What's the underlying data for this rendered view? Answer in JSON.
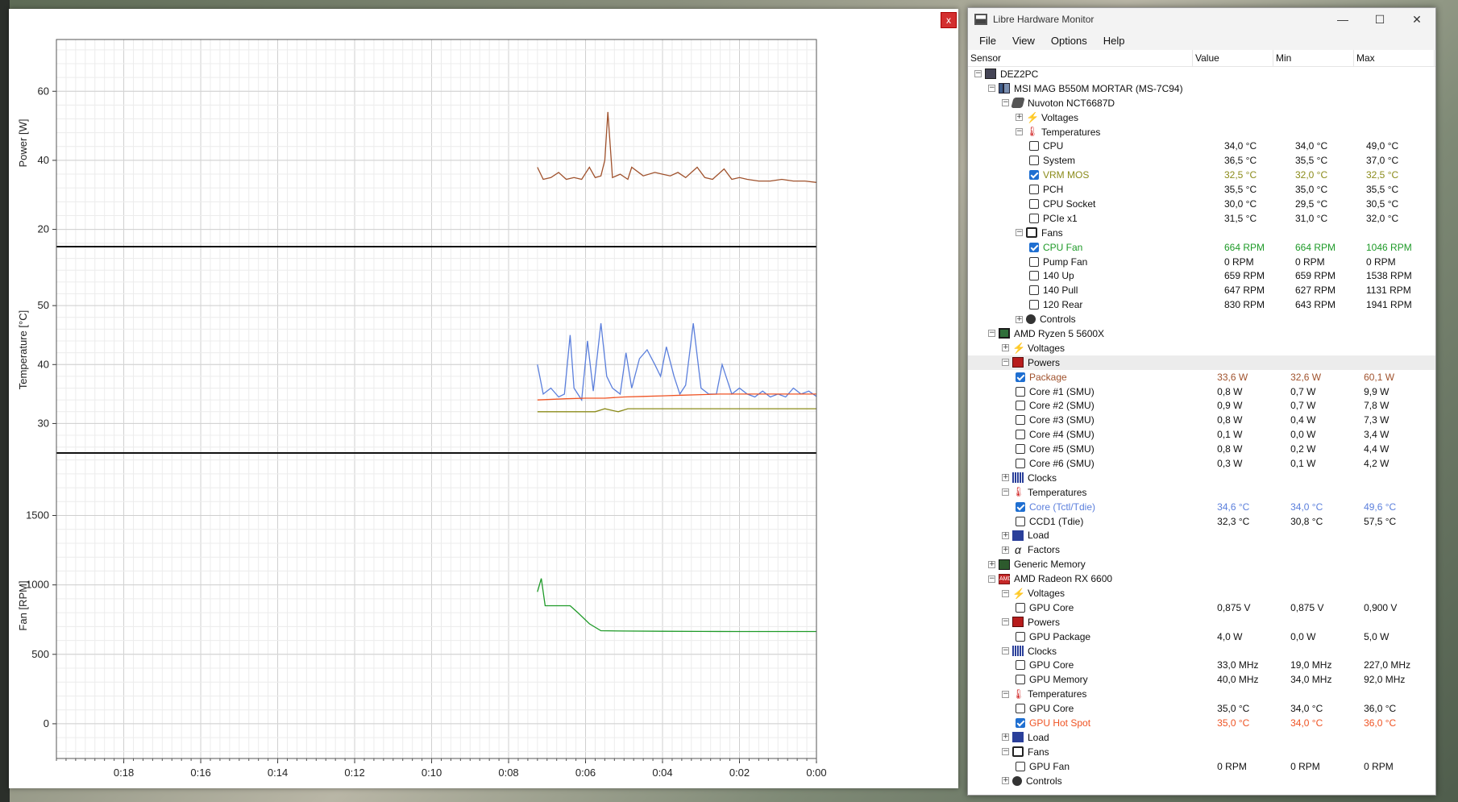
{
  "plot": {
    "close_label": "x",
    "panels": [
      {
        "ylabel": "Power [W]",
        "ylim": [
          15,
          75
        ],
        "yticks": [
          "60",
          "40",
          "20"
        ],
        "yvals": [
          60,
          40,
          20
        ]
      },
      {
        "ylabel": "Temperature [°C]",
        "ylim": [
          25,
          60
        ],
        "yticks": [
          "50",
          "40",
          "30"
        ],
        "yvals": [
          50,
          40,
          30
        ]
      },
      {
        "ylabel": "Fan [RPM]",
        "ylim": [
          -250,
          1950
        ],
        "yticks": [
          "1500",
          "1000",
          "500",
          "0"
        ],
        "yvals": [
          1500,
          1000,
          500,
          0
        ]
      }
    ],
    "xticks": [
      "0:18",
      "0:16",
      "0:14",
      "0:12",
      "0:10",
      "0:08",
      "0:06",
      "0:04",
      "0:02",
      "0:00"
    ],
    "colors": {
      "package": "#a0522d",
      "core": "#5b7fdc",
      "hotspot": "#ef5323",
      "vrm": "#8b8b1a",
      "cpufan": "#1e9a28"
    }
  },
  "chart_data": [
    {
      "type": "line",
      "ylabel": "Power [W]",
      "ylim": [
        15,
        75
      ],
      "series": [
        {
          "name": "Package",
          "x_minutes_ago": [
            7.25,
            7.1,
            6.9,
            6.7,
            6.5,
            6.3,
            6.1,
            5.9,
            5.75,
            5.6,
            5.5,
            5.42,
            5.3,
            5.1,
            4.9,
            4.8,
            4.5,
            4.2,
            4.0,
            3.8,
            3.6,
            3.4,
            3.1,
            2.9,
            2.7,
            2.4,
            2.2,
            2.0,
            1.8,
            1.5,
            1.2,
            0.9,
            0.6,
            0.3,
            0.0
          ],
          "values": [
            38,
            34.5,
            35,
            36.5,
            34.5,
            35,
            34.5,
            38,
            35,
            35.5,
            40,
            54,
            35,
            36,
            34.5,
            38,
            35.5,
            36.5,
            36,
            35.5,
            36.5,
            35,
            38,
            35,
            34.5,
            37.5,
            34.5,
            35,
            34.5,
            34,
            34,
            34.5,
            34,
            34,
            33.6
          ]
        }
      ]
    },
    {
      "type": "line",
      "ylabel": "Temperature [°C]",
      "ylim": [
        25,
        60
      ],
      "series": [
        {
          "name": "Core (Tctl/Tdie)",
          "x_minutes_ago": [
            7.25,
            7.1,
            6.9,
            6.7,
            6.55,
            6.4,
            6.3,
            6.1,
            5.95,
            5.8,
            5.6,
            5.45,
            5.3,
            5.1,
            4.95,
            4.8,
            4.6,
            4.4,
            4.2,
            4.05,
            3.9,
            3.7,
            3.55,
            3.4,
            3.2,
            3.0,
            2.8,
            2.6,
            2.45,
            2.2,
            2.0,
            1.8,
            1.6,
            1.4,
            1.2,
            1.0,
            0.8,
            0.6,
            0.4,
            0.2,
            0.0
          ],
          "values": [
            40,
            35,
            36,
            34.5,
            35,
            45,
            36,
            34,
            44,
            35.5,
            47,
            38,
            36,
            35,
            42,
            36,
            41,
            42.5,
            40,
            38,
            43,
            38,
            35,
            36.5,
            47,
            36,
            35,
            35,
            40,
            35,
            36,
            35,
            34.5,
            35.5,
            34.5,
            35,
            34.5,
            36,
            35,
            35.5,
            34.6
          ]
        },
        {
          "name": "GPU Hot Spot",
          "x_minutes_ago": [
            7.25,
            6.5,
            6.0,
            5.5,
            5.0,
            4.5,
            4.0,
            3.5,
            3.0,
            2.5,
            2.0,
            1.5,
            1.0,
            0.5,
            0.0
          ],
          "values": [
            34,
            34.2,
            34.3,
            34.3,
            34.5,
            34.6,
            34.7,
            34.8,
            34.9,
            35,
            35,
            35,
            35,
            35,
            35
          ]
        },
        {
          "name": "VRM MOS",
          "x_minutes_ago": [
            7.25,
            5.75,
            5.5,
            5.3,
            5.15,
            4.9,
            4.0,
            3.0,
            2.0,
            1.0,
            0.0
          ],
          "values": [
            32,
            32,
            32.5,
            32.2,
            32.0,
            32.5,
            32.5,
            32.5,
            32.5,
            32.5,
            32.5
          ]
        }
      ]
    },
    {
      "type": "line",
      "ylabel": "Fan [RPM]",
      "ylim": [
        -250,
        1950
      ],
      "series": [
        {
          "name": "CPU Fan",
          "x_minutes_ago": [
            7.25,
            7.15,
            7.05,
            6.95,
            6.6,
            6.4,
            6.2,
            5.9,
            5.6,
            5.0,
            4.0,
            3.0,
            2.0,
            1.0,
            0.0
          ],
          "values": [
            950,
            1046,
            850,
            850,
            850,
            850,
            800,
            720,
            670,
            668,
            666,
            665,
            664,
            664,
            664
          ]
        }
      ]
    }
  ],
  "window": {
    "title": "Libre Hardware Monitor",
    "menu": [
      "File",
      "View",
      "Options",
      "Help"
    ],
    "columns": [
      "Sensor",
      "Value",
      "Min",
      "Max"
    ]
  },
  "tree": [
    {
      "level": 0,
      "exp": "−",
      "icon": "pc",
      "name": "DEZ2PC"
    },
    {
      "level": 1,
      "exp": "−",
      "icon": "board",
      "name": "MSI MAG B550M MORTAR (MS-7C94)"
    },
    {
      "level": 2,
      "exp": "−",
      "icon": "chip",
      "name": "Nuvoton NCT6687D"
    },
    {
      "level": 3,
      "exp": "+",
      "icon": "volt",
      "name": "Voltages"
    },
    {
      "level": 3,
      "exp": "−",
      "icon": "temp",
      "name": "Temperatures"
    },
    {
      "level": 4,
      "check": false,
      "name": "CPU",
      "value": "34,0 °C",
      "min": "34,0 °C",
      "max": "49,0 °C"
    },
    {
      "level": 4,
      "check": false,
      "name": "System",
      "value": "36,5 °C",
      "min": "35,5 °C",
      "max": "37,0 °C"
    },
    {
      "level": 4,
      "check": true,
      "color": "#8b8b1a",
      "name": "VRM MOS",
      "value": "32,5 °C",
      "min": "32,0 °C",
      "max": "32,5 °C"
    },
    {
      "level": 4,
      "check": false,
      "name": "PCH",
      "value": "35,5 °C",
      "min": "35,0 °C",
      "max": "35,5 °C"
    },
    {
      "level": 4,
      "check": false,
      "name": "CPU Socket",
      "value": "30,0 °C",
      "min": "29,5 °C",
      "max": "30,5 °C"
    },
    {
      "level": 4,
      "check": false,
      "name": "PCIe x1",
      "value": "31,5 °C",
      "min": "31,0 °C",
      "max": "32,0 °C"
    },
    {
      "level": 3,
      "exp": "−",
      "icon": "fan",
      "name": "Fans"
    },
    {
      "level": 4,
      "check": true,
      "color": "#1e9a28",
      "name": "CPU Fan",
      "value": "664 RPM",
      "min": "664 RPM",
      "max": "1046 RPM"
    },
    {
      "level": 4,
      "check": false,
      "name": "Pump Fan",
      "value": "0 RPM",
      "min": "0 RPM",
      "max": "0 RPM"
    },
    {
      "level": 4,
      "check": false,
      "name": "140 Up",
      "value": "659 RPM",
      "min": "659 RPM",
      "max": "1538 RPM"
    },
    {
      "level": 4,
      "check": false,
      "name": "140 Pull",
      "value": "647 RPM",
      "min": "627 RPM",
      "max": "1131 RPM"
    },
    {
      "level": 4,
      "check": false,
      "name": "120 Rear",
      "value": "830 RPM",
      "min": "643 RPM",
      "max": "1941 RPM"
    },
    {
      "level": 3,
      "exp": "+",
      "icon": "ctrl",
      "name": "Controls"
    },
    {
      "level": 1,
      "exp": "−",
      "icon": "cpu",
      "name": "AMD Ryzen 5 5600X"
    },
    {
      "level": 2,
      "exp": "+",
      "icon": "volt",
      "name": "Voltages"
    },
    {
      "level": 2,
      "exp": "−",
      "icon": "pow",
      "name": "Powers",
      "selected": true
    },
    {
      "level": 3,
      "check": true,
      "color": "#a0522d",
      "name": "Package",
      "value": "33,6 W",
      "min": "32,6 W",
      "max": "60,1 W"
    },
    {
      "level": 3,
      "check": false,
      "name": "Core #1 (SMU)",
      "value": "0,8 W",
      "min": "0,7 W",
      "max": "9,9 W"
    },
    {
      "level": 3,
      "check": false,
      "name": "Core #2 (SMU)",
      "value": "0,9 W",
      "min": "0,7 W",
      "max": "7,8 W"
    },
    {
      "level": 3,
      "check": false,
      "name": "Core #3 (SMU)",
      "value": "0,8 W",
      "min": "0,4 W",
      "max": "7,3 W"
    },
    {
      "level": 3,
      "check": false,
      "name": "Core #4 (SMU)",
      "value": "0,1 W",
      "min": "0,0 W",
      "max": "3,4 W"
    },
    {
      "level": 3,
      "check": false,
      "name": "Core #5 (SMU)",
      "value": "0,8 W",
      "min": "0,2 W",
      "max": "4,4 W"
    },
    {
      "level": 3,
      "check": false,
      "name": "Core #6 (SMU)",
      "value": "0,3 W",
      "min": "0,1 W",
      "max": "4,2 W"
    },
    {
      "level": 2,
      "exp": "+",
      "icon": "clock",
      "name": "Clocks"
    },
    {
      "level": 2,
      "exp": "−",
      "icon": "temp",
      "name": "Temperatures"
    },
    {
      "level": 3,
      "check": true,
      "color": "#5b7fdc",
      "name": "Core (Tctl/Tdie)",
      "value": "34,6 °C",
      "min": "34,0 °C",
      "max": "49,6 °C"
    },
    {
      "level": 3,
      "check": false,
      "name": "CCD1 (Tdie)",
      "value": "32,3 °C",
      "min": "30,8 °C",
      "max": "57,5 °C"
    },
    {
      "level": 2,
      "exp": "+",
      "icon": "load",
      "name": "Load"
    },
    {
      "level": 2,
      "exp": "+",
      "icon": "fact",
      "name": "Factors"
    },
    {
      "level": 1,
      "exp": "+",
      "icon": "mem",
      "name": "Generic Memory"
    },
    {
      "level": 1,
      "exp": "−",
      "icon": "gpu",
      "name": "AMD Radeon RX 6600"
    },
    {
      "level": 2,
      "exp": "−",
      "icon": "volt",
      "name": "Voltages"
    },
    {
      "level": 3,
      "check": false,
      "name": "GPU Core",
      "value": "0,875 V",
      "min": "0,875 V",
      "max": "0,900 V"
    },
    {
      "level": 2,
      "exp": "−",
      "icon": "pow",
      "name": "Powers"
    },
    {
      "level": 3,
      "check": false,
      "name": "GPU Package",
      "value": "4,0 W",
      "min": "0,0 W",
      "max": "5,0 W"
    },
    {
      "level": 2,
      "exp": "−",
      "icon": "clock",
      "name": "Clocks"
    },
    {
      "level": 3,
      "check": false,
      "name": "GPU Core",
      "value": "33,0 MHz",
      "min": "19,0 MHz",
      "max": "227,0 MHz"
    },
    {
      "level": 3,
      "check": false,
      "name": "GPU Memory",
      "value": "40,0 MHz",
      "min": "34,0 MHz",
      "max": "92,0 MHz"
    },
    {
      "level": 2,
      "exp": "−",
      "icon": "temp",
      "name": "Temperatures"
    },
    {
      "level": 3,
      "check": false,
      "name": "GPU Core",
      "value": "35,0 °C",
      "min": "34,0 °C",
      "max": "36,0 °C"
    },
    {
      "level": 3,
      "check": true,
      "color": "#ef5323",
      "name": "GPU Hot Spot",
      "value": "35,0 °C",
      "min": "34,0 °C",
      "max": "36,0 °C"
    },
    {
      "level": 2,
      "exp": "+",
      "icon": "load",
      "name": "Load"
    },
    {
      "level": 2,
      "exp": "−",
      "icon": "fan",
      "name": "Fans"
    },
    {
      "level": 3,
      "check": false,
      "name": "GPU Fan",
      "value": "0 RPM",
      "min": "0 RPM",
      "max": "0 RPM"
    },
    {
      "level": 2,
      "exp": "+",
      "icon": "ctrl",
      "name": "Controls"
    }
  ]
}
